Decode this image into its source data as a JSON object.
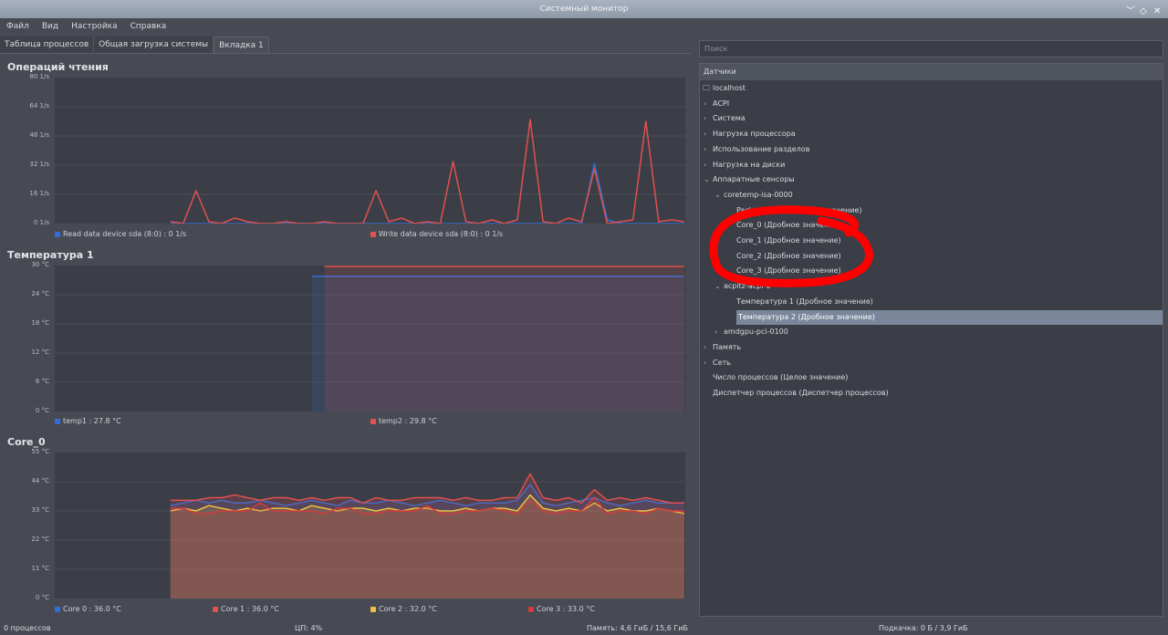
{
  "window": {
    "title": "Системный монитор",
    "controls": [
      "﹀",
      "◇",
      "✕"
    ]
  },
  "menu": [
    "Файл",
    "Вид",
    "Настройка",
    "Справка"
  ],
  "tabs": [
    {
      "label": "Таблица процессов"
    },
    {
      "label": "Общая загрузка системы"
    },
    {
      "label": "Вкладка 1",
      "active": true
    }
  ],
  "search": {
    "placeholder": "Поиск"
  },
  "tree": {
    "header": "Датчики",
    "nodes": [
      {
        "label": "localhost",
        "level": 0,
        "icon": "monitor-icon"
      },
      {
        "label": "ACPI",
        "level": 0,
        "expander": "collapsed"
      },
      {
        "label": "Система",
        "level": 0,
        "expander": "collapsed"
      },
      {
        "label": "Нагрузка процессора",
        "level": 0,
        "expander": "collapsed"
      },
      {
        "label": "Использование разделов",
        "level": 0,
        "expander": "collapsed"
      },
      {
        "label": "Нагрузка на диски",
        "level": 0,
        "expander": "collapsed"
      },
      {
        "label": "Аппаратные сенсоры",
        "level": 0,
        "expander": "expanded"
      },
      {
        "label": "coretemp-isa-0000",
        "level": 1,
        "expander": "expanded"
      },
      {
        "label": "Package id 0 (Дробное значение)",
        "level": 2
      },
      {
        "label": "Core_0 (Дробное значение)",
        "level": 2
      },
      {
        "label": "Core_1 (Дробное значение)",
        "level": 2
      },
      {
        "label": "Core_2 (Дробное значение)",
        "level": 2
      },
      {
        "label": "Core_3 (Дробное значение)",
        "level": 2
      },
      {
        "label": "acpitz-acpi-0",
        "level": 1,
        "expander": "expanded"
      },
      {
        "label": "Температура 1 (Дробное значение)",
        "level": 2
      },
      {
        "label": "Температура 2 (Дробное значение)",
        "level": 2,
        "selected": true
      },
      {
        "label": "amdgpu-pci-0100",
        "level": 1,
        "expander": "collapsed"
      },
      {
        "label": "Память",
        "level": 0,
        "expander": "collapsed"
      },
      {
        "label": "Сеть",
        "level": 0,
        "expander": "collapsed"
      },
      {
        "label": "Число процессов (Целое значение)",
        "level": 0
      },
      {
        "label": "Диспетчер процессов (Диспетчер процессов)",
        "level": 0
      }
    ]
  },
  "annotation": {
    "type": "red hand-drawn circle around Core_0..Core_3",
    "color": "#ff0000"
  },
  "status": {
    "processes": "0 процессов",
    "cpu": "ЦП: 4%",
    "memory": "Память: 4,6 ГиБ / 15,6 ГиБ",
    "swap": "Подкачка: 0 Б / 3,9 ГиБ"
  },
  "chart_data": [
    {
      "type": "line",
      "title": "Операций чтения",
      "ylim": [
        0,
        80
      ],
      "yticks": [
        "80 1/s",
        "64 1/s",
        "48 1/s",
        "32 1/s",
        "16 1/s",
        "0 1/s"
      ],
      "grid": true,
      "legend": "bottom",
      "fill": false,
      "series": [
        {
          "name": "Read data device sda (8:0) : 0 1/s",
          "color": "#2f6fd8",
          "values": [
            null,
            null,
            null,
            null,
            null,
            null,
            null,
            null,
            null,
            0,
            0,
            0,
            0,
            0,
            0,
            0,
            0,
            0,
            0,
            0,
            0,
            0,
            0,
            0,
            0,
            0,
            0,
            0,
            0,
            0,
            0,
            0,
            0,
            0,
            0,
            0,
            0,
            0,
            0,
            0,
            0,
            0,
            33,
            2,
            0,
            0,
            0,
            0,
            0,
            0
          ]
        },
        {
          "name": "Write data device sda (8:0) : 0 1/s",
          "color": "#e25050",
          "values": [
            null,
            null,
            null,
            null,
            null,
            null,
            null,
            null,
            null,
            1,
            0,
            18,
            1,
            0,
            3,
            1,
            0,
            0,
            1,
            0,
            0,
            1,
            0,
            0,
            0,
            18,
            1,
            3,
            0,
            1,
            0,
            34,
            1,
            0,
            2,
            0,
            2,
            57,
            1,
            0,
            3,
            1,
            30,
            0,
            1,
            2,
            56,
            1,
            2,
            1
          ]
        }
      ]
    },
    {
      "type": "area",
      "title": "Температура 1",
      "ylim": [
        0,
        30
      ],
      "yticks": [
        "30 °C",
        "24 °C",
        "18 °C",
        "12 °C",
        "6 °C",
        "0 °C"
      ],
      "grid": true,
      "legend": "bottom",
      "fill": true,
      "series": [
        {
          "name": "temp1 : 27.8 °C",
          "color": "#2f6fd8",
          "values": [
            null,
            null,
            null,
            null,
            null,
            null,
            null,
            null,
            null,
            null,
            null,
            null,
            null,
            null,
            null,
            null,
            null,
            null,
            null,
            null,
            27.8,
            27.8,
            27.8,
            27.8,
            27.8,
            27.8,
            27.8,
            27.8,
            27.8,
            27.8,
            27.8,
            27.8,
            27.8,
            27.8,
            27.8,
            27.8,
            27.8,
            27.8,
            27.8,
            27.8,
            27.8,
            27.8,
            27.8,
            27.8,
            27.8,
            27.8,
            27.8,
            27.8,
            27.8,
            27.8
          ]
        },
        {
          "name": "temp2 : 29.8 °C",
          "color": "#e25050",
          "values": [
            null,
            null,
            null,
            null,
            null,
            null,
            null,
            null,
            null,
            null,
            null,
            null,
            null,
            null,
            null,
            null,
            null,
            null,
            null,
            null,
            null,
            29.8,
            29.8,
            29.8,
            29.8,
            29.8,
            29.8,
            29.8,
            29.8,
            29.8,
            29.8,
            29.8,
            29.8,
            29.8,
            29.8,
            29.8,
            29.8,
            29.8,
            29.8,
            29.8,
            29.8,
            29.8,
            29.8,
            29.8,
            29.8,
            29.8,
            29.8,
            29.8,
            29.8,
            29.8
          ]
        }
      ]
    },
    {
      "type": "area",
      "title": "Core_0",
      "ylim": [
        0,
        55
      ],
      "yticks": [
        "55 °C",
        "44 °C",
        "33 °C",
        "22 °C",
        "11 °C",
        "0 °C"
      ],
      "grid": true,
      "legend": "bottom",
      "fill": true,
      "series": [
        {
          "name": "Core 0 : 36.0 °C",
          "color": "#2f6fd8",
          "values": [
            null,
            null,
            null,
            null,
            null,
            null,
            null,
            null,
            null,
            35,
            36,
            37,
            36,
            37,
            36,
            36,
            37,
            36,
            35,
            36,
            37,
            36,
            35,
            37,
            36,
            36,
            37,
            36,
            35,
            36,
            37,
            36,
            35,
            36,
            36,
            36,
            37,
            43,
            36,
            35,
            36,
            37,
            38,
            36,
            35,
            36,
            37,
            36,
            36,
            36
          ]
        },
        {
          "name": "Core 1 : 36.0 °C",
          "color": "#e25050",
          "values": [
            null,
            null,
            null,
            null,
            null,
            null,
            null,
            null,
            null,
            37,
            37,
            37,
            38,
            38,
            39,
            38,
            37,
            38,
            38,
            37,
            38,
            37,
            38,
            38,
            36,
            38,
            37,
            37,
            38,
            38,
            38,
            37,
            38,
            37,
            37,
            38,
            38,
            47,
            38,
            37,
            38,
            36,
            41,
            37,
            38,
            37,
            38,
            37,
            36,
            36
          ]
        },
        {
          "name": "Core 2 : 32.0 °C",
          "color": "#f0c040",
          "values": [
            null,
            null,
            null,
            null,
            null,
            null,
            null,
            null,
            null,
            33,
            34,
            33,
            35,
            34,
            33,
            34,
            33,
            34,
            34,
            33,
            35,
            34,
            33,
            34,
            34,
            33,
            34,
            33,
            34,
            34,
            33,
            33,
            34,
            33,
            34,
            34,
            33,
            39,
            34,
            33,
            34,
            33,
            36,
            33,
            34,
            33,
            33,
            34,
            33,
            32
          ]
        },
        {
          "name": "Core 3 : 33.0 °C",
          "color": "#d23c3c",
          "values": [
            null,
            null,
            null,
            null,
            null,
            null,
            null,
            null,
            null,
            34,
            34,
            32,
            32,
            33,
            33,
            33,
            36,
            33,
            33,
            33,
            33,
            32,
            34,
            34,
            32,
            32,
            33,
            33,
            33,
            35,
            32,
            32,
            33,
            33,
            34,
            33,
            32,
            37,
            33,
            32,
            33,
            33,
            38,
            32,
            33,
            33,
            32,
            34,
            33,
            33
          ]
        }
      ]
    }
  ]
}
